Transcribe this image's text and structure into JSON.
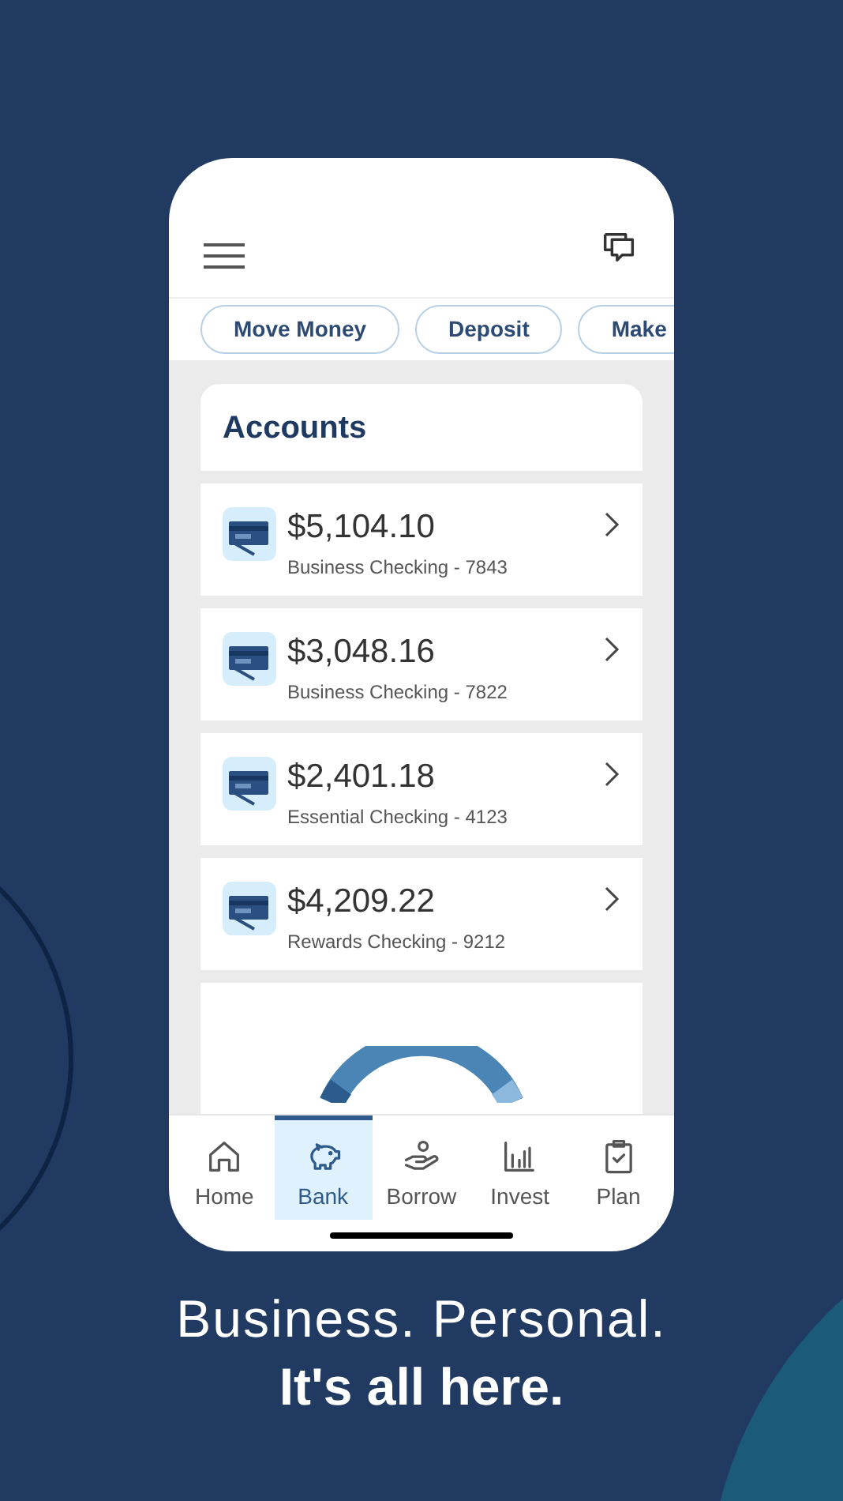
{
  "quick_actions": [
    {
      "label": "Move Money"
    },
    {
      "label": "Deposit"
    },
    {
      "label": "Make"
    }
  ],
  "accounts_title": "Accounts",
  "accounts": [
    {
      "balance": "$5,104.10",
      "name": "Business Checking - 7843"
    },
    {
      "balance": "$3,048.16",
      "name": "Business Checking - 7822"
    },
    {
      "balance": "$2,401.18",
      "name": "Essential Checking - 4123"
    },
    {
      "balance": "$4,209.22",
      "name": "Rewards Checking - 9212"
    }
  ],
  "nav": [
    {
      "label": "Home",
      "kind": "home",
      "selected": false
    },
    {
      "label": "Bank",
      "kind": "bank",
      "selected": true
    },
    {
      "label": "Borrow",
      "kind": "borrow",
      "selected": false
    },
    {
      "label": "Invest",
      "kind": "invest",
      "selected": false
    },
    {
      "label": "Plan",
      "kind": "plan",
      "selected": false
    }
  ],
  "caption": {
    "line1": "Business. Personal.",
    "line2": "It's all here."
  }
}
